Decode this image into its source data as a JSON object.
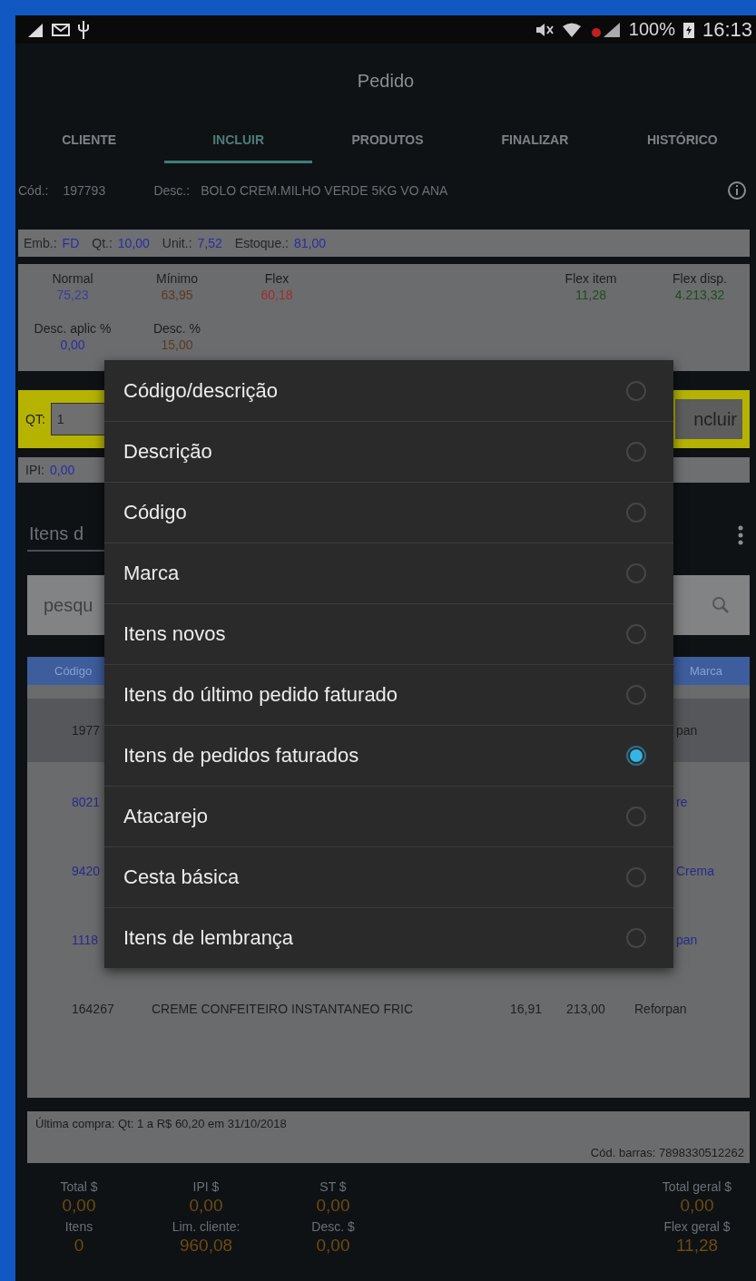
{
  "status_bar": {
    "battery": "100%",
    "time": "16:13"
  },
  "title": "Pedido",
  "tabs": [
    {
      "label": "CLIENTE",
      "selected": false
    },
    {
      "label": "INCLUIR",
      "selected": true
    },
    {
      "label": "PRODUTOS",
      "selected": false
    },
    {
      "label": "FINALIZAR",
      "selected": false
    },
    {
      "label": "HISTÓRICO",
      "selected": false
    }
  ],
  "product": {
    "code_label": "Cód.:",
    "code": "197793",
    "desc_label": "Desc.:",
    "desc": "BOLO CREM.MILHO VERDE 5KG VO ANA"
  },
  "stock_bar": [
    {
      "label": "Emb.:",
      "value": "FD"
    },
    {
      "label": "Qt.:",
      "value": "10,00"
    },
    {
      "label": "Unit.:",
      "value": "7,52"
    },
    {
      "label": "Estoque.:",
      "value": "81,00"
    }
  ],
  "prices": [
    {
      "label": "Normal",
      "value": "75,23",
      "color": "#3c3c9c"
    },
    {
      "label": "Mínimo",
      "value": "63,95",
      "color": "#5c3a20"
    },
    {
      "label": "Flex",
      "value": "60,18",
      "color": "#a02c2c"
    },
    {
      "label": "Flex item",
      "value": "11,28",
      "color": "#1c4f1c"
    },
    {
      "label": "Flex disp.",
      "value": "4.213,32",
      "color": "#1c4f1c"
    }
  ],
  "discounts": [
    {
      "label": "Desc. aplic %",
      "value": "0,00"
    },
    {
      "label": "Desc. %",
      "value": "15,00"
    }
  ],
  "order": {
    "qt_label": "QT:",
    "qt_value": "1",
    "add_button": "ncluir",
    "ipi_label": "IPI:",
    "ipi_value": "0,00"
  },
  "list_title": "Itens d",
  "search": {
    "placeholder": "pesqu"
  },
  "table": {
    "columns": [
      "Código",
      "Marca"
    ],
    "rows": [
      {
        "kind": "covered",
        "selected": true,
        "color": "#1e1e1e",
        "code": "1977",
        "marca": "pan"
      },
      {
        "kind": "covered",
        "selected": false,
        "color": "#2a2a8a",
        "code": "8021",
        "marca": "re"
      },
      {
        "kind": "covered",
        "selected": false,
        "color": "#2a2a8a",
        "code": "9420",
        "marca": "Crema"
      },
      {
        "kind": "covered",
        "selected": false,
        "color": "#2a2a8a",
        "code": "1118",
        "marca": "pan"
      },
      {
        "kind": "full",
        "selected": false,
        "color": "#1e1e1e",
        "code": "164267",
        "desc": "CREME CONFEITEIRO INSTANTANEO FRIC",
        "price": "16,91",
        "stock": "213,00",
        "marca": "Reforpan"
      }
    ]
  },
  "last_purchase": "Última compra: Qt: 1 a R$ 60,20 em 31/10/2018",
  "barcode": "Cód. barras: 7898330512262",
  "totals": [
    [
      {
        "label": "Total $",
        "value": "0,00"
      },
      {
        "label": "IPI $",
        "value": "0,00"
      },
      {
        "label": "ST $",
        "value": "0,00"
      },
      {
        "label": "Total geral $",
        "value": "0,00"
      }
    ],
    [
      {
        "label": "Itens",
        "value": "0"
      },
      {
        "label": "Lim. cliente:",
        "value": "960,08"
      },
      {
        "label": "Desc. $",
        "value": "0,00"
      },
      {
        "label": "Flex geral $",
        "value": "11,28"
      }
    ]
  ],
  "dialog": {
    "options": [
      {
        "label": "Código/descrição",
        "selected": false
      },
      {
        "label": "Descrição",
        "selected": false
      },
      {
        "label": "Código",
        "selected": false
      },
      {
        "label": "Marca",
        "selected": false
      },
      {
        "label": "Itens novos",
        "selected": false
      },
      {
        "label": "Itens do último pedido faturado",
        "selected": false
      },
      {
        "label": "Itens de pedidos faturados",
        "selected": true
      },
      {
        "label": "Atacarejo",
        "selected": false
      },
      {
        "label": "Cesta básica",
        "selected": false
      },
      {
        "label": "Itens de lembrança",
        "selected": false
      }
    ]
  }
}
